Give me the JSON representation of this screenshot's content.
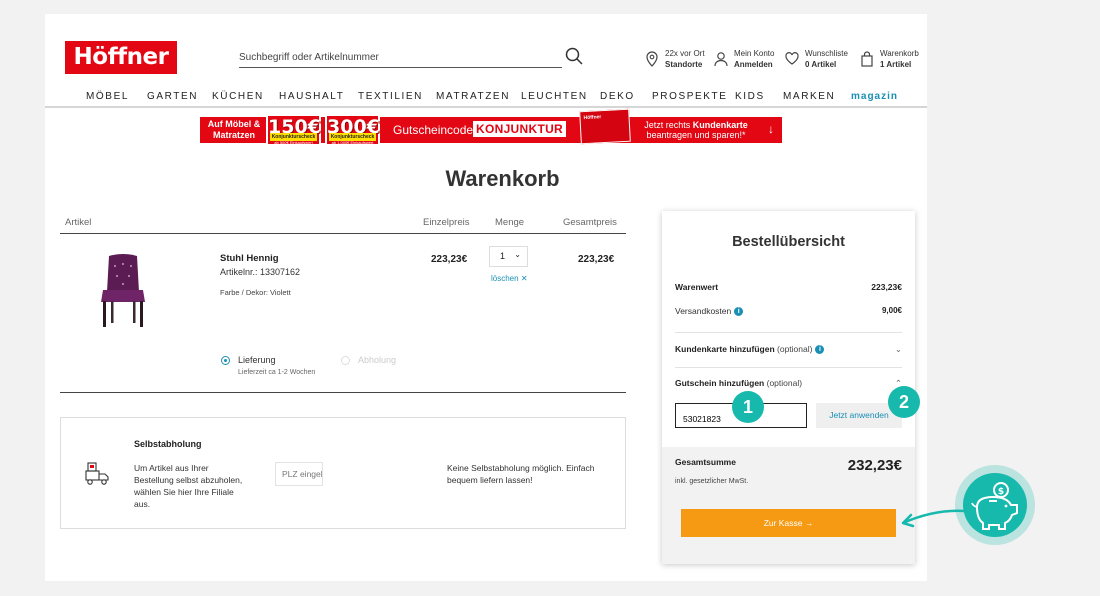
{
  "header": {
    "logo": "Höffner",
    "search_placeholder": "Suchbegriff oder Artikelnummer",
    "location": {
      "line1": "22x vor Ort",
      "line2": "Standorte"
    },
    "account": {
      "line1": "Mein Konto",
      "line2": "Anmelden"
    },
    "wishlist": {
      "line1": "Wunschliste",
      "line2": "0 Artikel"
    },
    "cart": {
      "line1": "Warenkorb",
      "line2": "1 Artikel"
    }
  },
  "nav": [
    "MÖBEL",
    "GARTEN",
    "KÜCHEN",
    "HAUSHALT",
    "TEXTILIEN",
    "MATRATZEN",
    "LEUCHTEN",
    "DEKO",
    "PROSPEKTE",
    "KIDS",
    "MARKEN",
    "magazin"
  ],
  "banner": {
    "left_text": "Auf Möbel & Matratzen",
    "badge1": {
      "amount": "150€",
      "label": "Konjunkturscheck",
      "sub": "ab 500€ Einkaufswert"
    },
    "badge2": {
      "amount": "300€",
      "label": "Konjunkturscheck",
      "sub": "ab 1.000€ Einkaufswert"
    },
    "code_label": "Gutscheincode:",
    "code": "KONJUNKTUR",
    "card_text": "Höffner",
    "right_text_1": "Jetzt rechts",
    "right_text_bold": "Kundenkarte",
    "right_text_2": "beantragen und sparen!*",
    "arrow": "↓"
  },
  "page_title": "Warenkorb",
  "table": {
    "headers": {
      "article": "Artikel",
      "unit_price": "Einzelpreis",
      "quantity": "Menge",
      "total_price": "Gesamtpreis"
    },
    "item": {
      "name": "Stuhl Hennig",
      "article_number": "Artikelnr.: 13307162",
      "color": "Farbe / Dekor: Violett",
      "unit_price": "223,23€",
      "quantity": "1",
      "delete": "löschen",
      "total_price": "223,23€"
    },
    "delivery": {
      "label": "Lieferung",
      "sub": "Lieferzeit ca 1-2 Wochen",
      "pickup_label": "Abholung"
    }
  },
  "pickup": {
    "title": "Selbstabholung",
    "description": "Um Artikel aus Ihrer Bestellung selbst abzuholen, wählen Sie hier Ihre Filiale aus.",
    "plz_placeholder": "PLZ eingeben",
    "message": "Keine Selbstabholung möglich. Einfach bequem liefern lassen!"
  },
  "summary": {
    "title": "Bestellübersicht",
    "goods_label": "Warenwert",
    "goods_value": "223,23€",
    "shipping_label": "Versandkosten",
    "shipping_value": "9,00€",
    "customer_card": "Kundenkarte hinzufügen",
    "optional": "(optional)",
    "voucher": "Gutschein hinzufügen",
    "voucher_value": "53021823",
    "apply": "Jetzt anwenden",
    "total_label": "Gesamtsumme",
    "total_value": "232,23€",
    "vat_note": "inkl. gesetzlicher MwSt.",
    "checkout": "Zur Kasse"
  },
  "callouts": {
    "one": "1",
    "two": "2"
  },
  "colors": {
    "brand_red": "#e30613",
    "accent_blue": "#1a8fb5",
    "checkout_orange": "#f59a12",
    "callout_teal": "#18b9ad"
  }
}
